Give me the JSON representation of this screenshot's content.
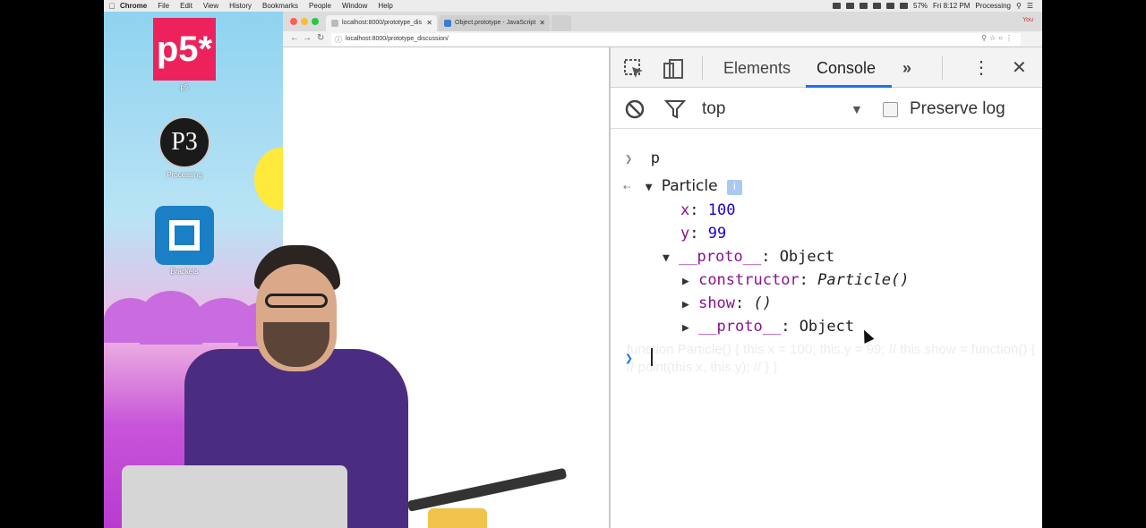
{
  "menubar": {
    "app": "Chrome",
    "items": [
      "File",
      "Edit",
      "View",
      "History",
      "Bookmarks",
      "People",
      "Window",
      "Help"
    ],
    "battery": "57%",
    "clock": "Fri 8:12 PM",
    "right_app": "Processing"
  },
  "desktop": {
    "icons": [
      {
        "label": "p5",
        "glyph": "p5*"
      },
      {
        "label": "Processing",
        "glyph": "P3"
      },
      {
        "label": "Brackets"
      }
    ]
  },
  "browser": {
    "tabs": [
      {
        "title": "localhost:8000/prototype_dis",
        "active": true
      },
      {
        "title": "Object.prototype - JavaScript",
        "active": false
      }
    ],
    "profile": "You",
    "url": "localhost:8000/prototype_discussion/"
  },
  "devtools": {
    "tabs": {
      "elements": "Elements",
      "console": "Console",
      "more": "»"
    },
    "filter": {
      "context": "top",
      "preserve_log": "Preserve log"
    },
    "console": {
      "input_line": "p",
      "object_name": "Particle",
      "info_badge": "i",
      "x_key": "x",
      "x_val": "100",
      "y_key": "y",
      "y_val": "99",
      "proto_key": "__proto__",
      "proto_val": "Object",
      "constructor_key": "constructor",
      "constructor_val": "Particle()",
      "show_key": "show",
      "show_val": "()",
      "proto2_key": "__proto__",
      "proto2_val": "Object",
      "ghost_text": "function Particle() { this.x = 100; this.y = 99; // this.show = function() { // point(this.x, this.y); // } }"
    }
  },
  "colors": {
    "accent": "#1a73e8",
    "key": "#881391",
    "number": "#1c00cf",
    "p5": "#ed225d"
  }
}
